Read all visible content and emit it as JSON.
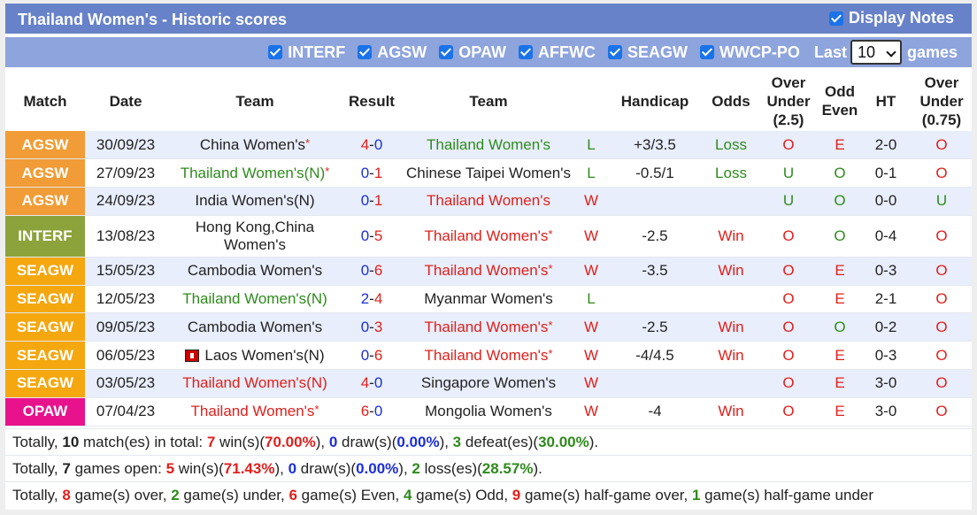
{
  "header": {
    "title": "Thailand Women's - Historic scores",
    "display_notes_label": "Display Notes"
  },
  "filters": {
    "items": [
      "INTERF",
      "AGSW",
      "OPAW",
      "AFFWC",
      "SEAGW",
      "WWCP-PO"
    ],
    "last_label": "Last",
    "games_value": "10",
    "games_label": "games"
  },
  "columns": {
    "match": "Match",
    "date": "Date",
    "team_home": "Team",
    "result": "Result",
    "team_away": "Team",
    "handicap": "Handicap",
    "odds": "Odds",
    "ou_line1": "Over",
    "ou_line2": "Under",
    "ou_line3": "(2.5)",
    "oe_line1": "Odd",
    "oe_line2": "Even",
    "ht": "HT",
    "ou75_line1": "Over",
    "ou75_line2": "Under",
    "ou75_line3": "(0.75)"
  },
  "colors": {
    "AGSW": "#f19c36",
    "INTERF": "#8ca33b",
    "SEAGW": "#f5a70f",
    "OPAW": "#e8128c",
    "title_bar": "#6782c8",
    "filter_bar": "#8ea4dc"
  },
  "rows": [
    {
      "league": "AGSW",
      "date": "30/09/23",
      "home": "China Women's",
      "home_star": "*",
      "home_neutral": "",
      "home_color": "plain",
      "home_flag": false,
      "score_h": "4",
      "score_a": "0",
      "score_h_color": "red",
      "score_a_color": "blue",
      "away": "Thailand Women's",
      "away_star": "",
      "away_color": "green",
      "wl": "L",
      "wl_color": "green",
      "handicap": "+3/3.5",
      "odds": "Loss",
      "odds_color": "green",
      "ou": "O",
      "ou_color": "red",
      "oe": "E",
      "oe_color": "red",
      "ht": "2-0",
      "ou75": "O",
      "ou75_color": "red"
    },
    {
      "league": "AGSW",
      "date": "27/09/23",
      "home": "Thailand Women's",
      "home_star": "*",
      "home_neutral": "(N)",
      "home_color": "green",
      "home_flag": false,
      "score_h": "0",
      "score_a": "1",
      "score_h_color": "blue",
      "score_a_color": "red",
      "away": "Chinese Taipei Women's",
      "away_star": "",
      "away_color": "plain",
      "wl": "L",
      "wl_color": "green",
      "handicap": "-0.5/1",
      "odds": "Loss",
      "odds_color": "green",
      "ou": "U",
      "ou_color": "green",
      "oe": "O",
      "oe_color": "green",
      "ht": "0-1",
      "ou75": "O",
      "ou75_color": "red"
    },
    {
      "league": "AGSW",
      "date": "24/09/23",
      "home": "India Women's",
      "home_star": "",
      "home_neutral": "(N)",
      "home_color": "plain",
      "home_flag": false,
      "score_h": "0",
      "score_a": "1",
      "score_h_color": "blue",
      "score_a_color": "red",
      "away": "Thailand Women's",
      "away_star": "",
      "away_color": "red",
      "wl": "W",
      "wl_color": "red",
      "handicap": "",
      "odds": "",
      "odds_color": "red",
      "ou": "U",
      "ou_color": "green",
      "oe": "O",
      "oe_color": "green",
      "ht": "0-0",
      "ou75": "U",
      "ou75_color": "green"
    },
    {
      "league": "INTERF",
      "date": "13/08/23",
      "home": "Hong Kong,China Women's",
      "home_star": "",
      "home_neutral": "",
      "home_color": "plain",
      "home_flag": false,
      "score_h": "0",
      "score_a": "5",
      "score_h_color": "blue",
      "score_a_color": "red",
      "away": "Thailand Women's",
      "away_star": "*",
      "away_color": "red",
      "wl": "W",
      "wl_color": "red",
      "handicap": "-2.5",
      "odds": "Win",
      "odds_color": "red",
      "ou": "O",
      "ou_color": "red",
      "oe": "O",
      "oe_color": "green",
      "ht": "0-4",
      "ou75": "O",
      "ou75_color": "red"
    },
    {
      "league": "SEAGW",
      "date": "15/05/23",
      "home": "Cambodia Women's",
      "home_star": "",
      "home_neutral": "",
      "home_color": "plain",
      "home_flag": false,
      "score_h": "0",
      "score_a": "6",
      "score_h_color": "blue",
      "score_a_color": "red",
      "away": "Thailand Women's",
      "away_star": "*",
      "away_color": "red",
      "wl": "W",
      "wl_color": "red",
      "handicap": "-3.5",
      "odds": "Win",
      "odds_color": "red",
      "ou": "O",
      "ou_color": "red",
      "oe": "E",
      "oe_color": "red",
      "ht": "0-3",
      "ou75": "O",
      "ou75_color": "red"
    },
    {
      "league": "SEAGW",
      "date": "12/05/23",
      "home": "Thailand Women's",
      "home_star": "",
      "home_neutral": "(N)",
      "home_color": "green",
      "home_flag": false,
      "score_h": "2",
      "score_a": "4",
      "score_h_color": "blue",
      "score_a_color": "red",
      "away": "Myanmar Women's",
      "away_star": "",
      "away_color": "plain",
      "wl": "L",
      "wl_color": "green",
      "handicap": "",
      "odds": "",
      "odds_color": "red",
      "ou": "O",
      "ou_color": "red",
      "oe": "E",
      "oe_color": "red",
      "ht": "2-1",
      "ou75": "O",
      "ou75_color": "red"
    },
    {
      "league": "SEAGW",
      "date": "09/05/23",
      "home": "Cambodia Women's",
      "home_star": "",
      "home_neutral": "",
      "home_color": "plain",
      "home_flag": false,
      "score_h": "0",
      "score_a": "3",
      "score_h_color": "blue",
      "score_a_color": "red",
      "away": "Thailand Women's",
      "away_star": "*",
      "away_color": "red",
      "wl": "W",
      "wl_color": "red",
      "handicap": "-2.5",
      "odds": "Win",
      "odds_color": "red",
      "ou": "O",
      "ou_color": "red",
      "oe": "O",
      "oe_color": "green",
      "ht": "0-2",
      "ou75": "O",
      "ou75_color": "red"
    },
    {
      "league": "SEAGW",
      "date": "06/05/23",
      "home": "Laos Women's",
      "home_star": "",
      "home_neutral": "(N)",
      "home_color": "plain",
      "home_flag": true,
      "score_h": "0",
      "score_a": "6",
      "score_h_color": "blue",
      "score_a_color": "red",
      "away": "Thailand Women's",
      "away_star": "*",
      "away_color": "red",
      "wl": "W",
      "wl_color": "red",
      "handicap": "-4/4.5",
      "odds": "Win",
      "odds_color": "red",
      "ou": "O",
      "ou_color": "red",
      "oe": "E",
      "oe_color": "red",
      "ht": "0-3",
      "ou75": "O",
      "ou75_color": "red"
    },
    {
      "league": "SEAGW",
      "date": "03/05/23",
      "home": "Thailand Women's",
      "home_star": "",
      "home_neutral": "(N)",
      "home_color": "red",
      "home_flag": false,
      "score_h": "4",
      "score_a": "0",
      "score_h_color": "red",
      "score_a_color": "blue",
      "away": "Singapore Women's",
      "away_star": "",
      "away_color": "plain",
      "wl": "W",
      "wl_color": "red",
      "handicap": "",
      "odds": "",
      "odds_color": "red",
      "ou": "O",
      "ou_color": "red",
      "oe": "E",
      "oe_color": "red",
      "ht": "3-0",
      "ou75": "O",
      "ou75_color": "red"
    },
    {
      "league": "OPAW",
      "date": "07/04/23",
      "home": "Thailand Women's",
      "home_star": "*",
      "home_neutral": "",
      "home_color": "red",
      "home_flag": false,
      "score_h": "6",
      "score_a": "0",
      "score_h_color": "red",
      "score_a_color": "blue",
      "away": "Mongolia Women's",
      "away_star": "",
      "away_color": "plain",
      "wl": "W",
      "wl_color": "red",
      "handicap": "-4",
      "odds": "Win",
      "odds_color": "red",
      "ou": "O",
      "ou_color": "red",
      "oe": "E",
      "oe_color": "red",
      "ht": "3-0",
      "ou75": "O",
      "ou75_color": "red"
    }
  ],
  "summary": {
    "line1": [
      {
        "t": "Totally, ",
        "c": ""
      },
      {
        "t": "10",
        "c": "b"
      },
      {
        "t": " match(es) in total: ",
        "c": ""
      },
      {
        "t": "7",
        "c": "red"
      },
      {
        "t": " win(s)(",
        "c": ""
      },
      {
        "t": "70.00%",
        "c": "red"
      },
      {
        "t": "), ",
        "c": ""
      },
      {
        "t": "0",
        "c": "blue"
      },
      {
        "t": " draw(s)(",
        "c": ""
      },
      {
        "t": "0.00%",
        "c": "blue"
      },
      {
        "t": "), ",
        "c": ""
      },
      {
        "t": "3",
        "c": "green"
      },
      {
        "t": " defeat(es)(",
        "c": ""
      },
      {
        "t": "30.00%",
        "c": "green"
      },
      {
        "t": ").",
        "c": ""
      }
    ],
    "line2": [
      {
        "t": "Totally, ",
        "c": ""
      },
      {
        "t": "7",
        "c": "b"
      },
      {
        "t": " games open: ",
        "c": ""
      },
      {
        "t": "5",
        "c": "red"
      },
      {
        "t": " win(s)(",
        "c": ""
      },
      {
        "t": "71.43%",
        "c": "red"
      },
      {
        "t": "), ",
        "c": ""
      },
      {
        "t": "0",
        "c": "blue"
      },
      {
        "t": " draw(s)(",
        "c": ""
      },
      {
        "t": "0.00%",
        "c": "blue"
      },
      {
        "t": "), ",
        "c": ""
      },
      {
        "t": "2",
        "c": "green"
      },
      {
        "t": " loss(es)(",
        "c": ""
      },
      {
        "t": "28.57%",
        "c": "green"
      },
      {
        "t": ").",
        "c": ""
      }
    ],
    "line3": [
      {
        "t": "Totally, ",
        "c": ""
      },
      {
        "t": "8",
        "c": "red"
      },
      {
        "t": " game(s) over, ",
        "c": ""
      },
      {
        "t": "2",
        "c": "green"
      },
      {
        "t": " game(s) under, ",
        "c": ""
      },
      {
        "t": "6",
        "c": "red"
      },
      {
        "t": " game(s) Even, ",
        "c": ""
      },
      {
        "t": "4",
        "c": "green"
      },
      {
        "t": " game(s) Odd, ",
        "c": ""
      },
      {
        "t": "9",
        "c": "red"
      },
      {
        "t": " game(s) half-game over, ",
        "c": ""
      },
      {
        "t": "1",
        "c": "green"
      },
      {
        "t": " game(s) half-game under",
        "c": ""
      }
    ]
  }
}
